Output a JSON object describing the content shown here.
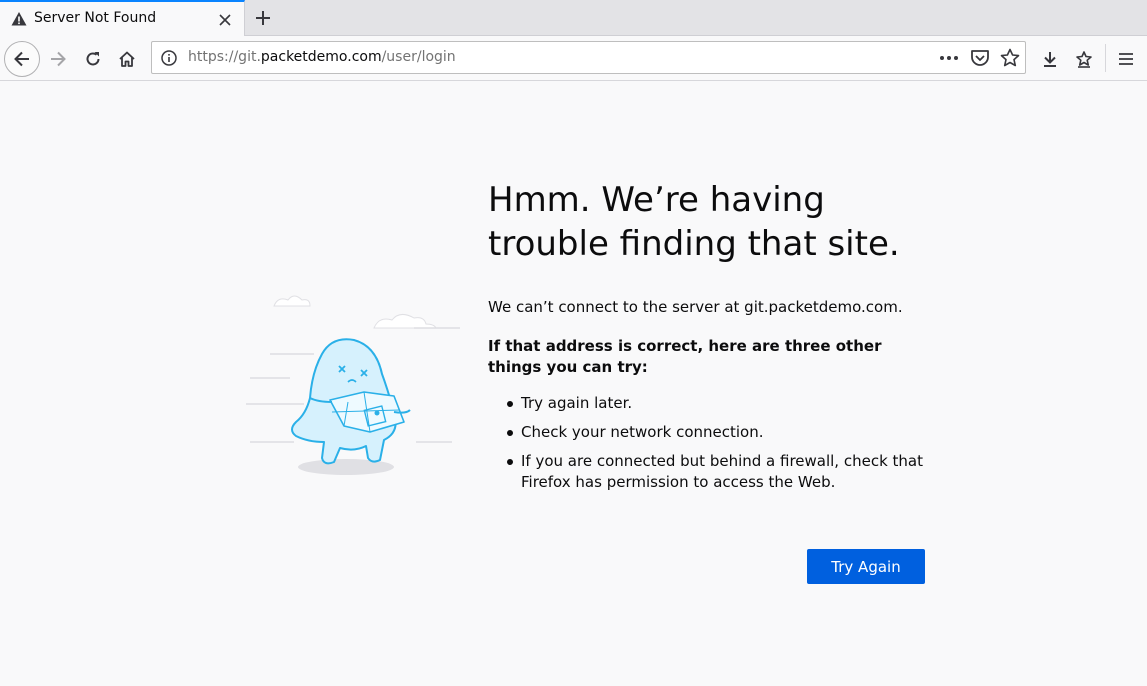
{
  "tab": {
    "title": "Server Not Found",
    "icon": "warning-icon"
  },
  "nav": {
    "url_scheme_sub": "https://git.",
    "url_host": "packetdemo.com",
    "url_path": "/user/login"
  },
  "content": {
    "headline": "Hmm. We’re having trouble finding that site.",
    "message": "We can’t connect to the server at git.packetdemo.com.",
    "suggestions_heading": "If that address is correct, here are three other things you can try:",
    "suggestions": [
      "Try again later.",
      "Check your network connection.",
      "If you are connected but behind a firewall, check that Firefox has permission to access the Web."
    ],
    "try_again_label": "Try Again"
  },
  "colors": {
    "accent": "#0a84ff",
    "button": "#0060df",
    "illustration": "#2ab0e8"
  }
}
